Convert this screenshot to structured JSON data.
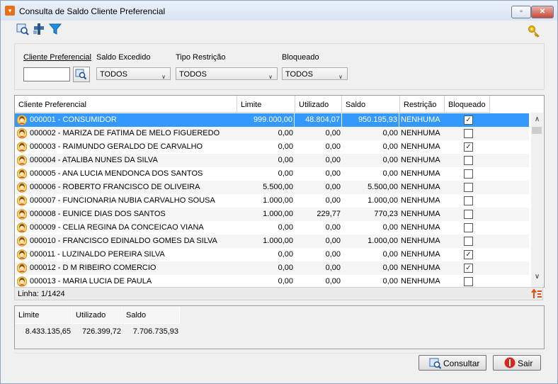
{
  "window": {
    "title": "Consulta de Saldo Cliente Preferencial",
    "min_symbol": "▫",
    "close_symbol": "✕"
  },
  "toolbar": {
    "icons": [
      "search-icon",
      "tools-icon",
      "filter-icon",
      "key-icon"
    ]
  },
  "filters": {
    "cliente_label": "Cliente Preferencial",
    "cliente_value": "",
    "saldo_label": "Saldo Excedido",
    "saldo_value": "TODOS",
    "tipo_label": "Tipo Restrição",
    "tipo_value": "TODOS",
    "bloqueado_label": "Bloqueado",
    "bloqueado_value": "TODOS"
  },
  "grid": {
    "columns": [
      "Cliente Preferencial",
      "Limite",
      "Utilizado",
      "Saldo",
      "Restrição",
      "Bloqueado"
    ],
    "rows": [
      {
        "name": "000001 - CONSUMIDOR",
        "limite": "999.000,00",
        "utilizado": "48.804,07",
        "saldo": "950.195,93",
        "restricao": "NENHUMA",
        "bloqueado": true,
        "selected": true
      },
      {
        "name": "000002 - MARIZA DE FATIMA DE MELO FIGUEREDO",
        "limite": "0,00",
        "utilizado": "0,00",
        "saldo": "0,00",
        "restricao": "NENHUMA",
        "bloqueado": false
      },
      {
        "name": "000003 - RAIMUNDO GERALDO DE CARVALHO",
        "limite": "0,00",
        "utilizado": "0,00",
        "saldo": "0,00",
        "restricao": "NENHUMA",
        "bloqueado": true
      },
      {
        "name": "000004 - ATALIBA NUNES DA SILVA",
        "limite": "0,00",
        "utilizado": "0,00",
        "saldo": "0,00",
        "restricao": "NENHUMA",
        "bloqueado": false
      },
      {
        "name": "000005 - ANA LUCIA MENDONCA DOS SANTOS",
        "limite": "0,00",
        "utilizado": "0,00",
        "saldo": "0,00",
        "restricao": "NENHUMA",
        "bloqueado": false
      },
      {
        "name": "000006 - ROBERTO FRANCISCO DE OLIVEIRA",
        "limite": "5.500,00",
        "utilizado": "0,00",
        "saldo": "5.500,00",
        "restricao": "NENHUMA",
        "bloqueado": false
      },
      {
        "name": "000007 - FUNCIONARIA NUBIA CARVALHO SOUSA",
        "limite": "1.000,00",
        "utilizado": "0,00",
        "saldo": "1.000,00",
        "restricao": "NENHUMA",
        "bloqueado": false
      },
      {
        "name": "000008 - EUNICE DIAS DOS SANTOS",
        "limite": "1.000,00",
        "utilizado": "229,77",
        "saldo": "770,23",
        "restricao": "NENHUMA",
        "bloqueado": false
      },
      {
        "name": "000009 - CELIA REGINA DA CONCEICAO VIANA",
        "limite": "0,00",
        "utilizado": "0,00",
        "saldo": "0,00",
        "restricao": "NENHUMA",
        "bloqueado": false
      },
      {
        "name": "000010 - FRANCISCO EDINALDO GOMES DA SILVA",
        "limite": "1.000,00",
        "utilizado": "0,00",
        "saldo": "1.000,00",
        "restricao": "NENHUMA",
        "bloqueado": false
      },
      {
        "name": "000011 - LUZINALDO PEREIRA SILVA",
        "limite": "0,00",
        "utilizado": "0,00",
        "saldo": "0,00",
        "restricao": "NENHUMA",
        "bloqueado": true
      },
      {
        "name": "000012 - D M RIBEIRO COMERCIO",
        "limite": "0,00",
        "utilizado": "0,00",
        "saldo": "0,00",
        "restricao": "NENHUMA",
        "bloqueado": true
      },
      {
        "name": "000013 - MARIA LUCIA DE PAULA",
        "limite": "0,00",
        "utilizado": "0,00",
        "saldo": "0,00",
        "restricao": "NENHUMA",
        "bloqueado": false
      }
    ]
  },
  "status": {
    "linha": "Linha: 1/1424"
  },
  "totals": {
    "limite_label": "Limite",
    "utilizado_label": "Utilizado",
    "saldo_label": "Saldo",
    "limite_value": "8.433.135,65",
    "utilizado_value": "726.399,72",
    "saldo_value": "7.706.735,93"
  },
  "buttons": {
    "consultar": "Consultar",
    "sair": "Sair"
  },
  "colors": {
    "selection": "#3399ff",
    "accent_orange": "#e8701a",
    "key_gold": "#f0b400"
  }
}
